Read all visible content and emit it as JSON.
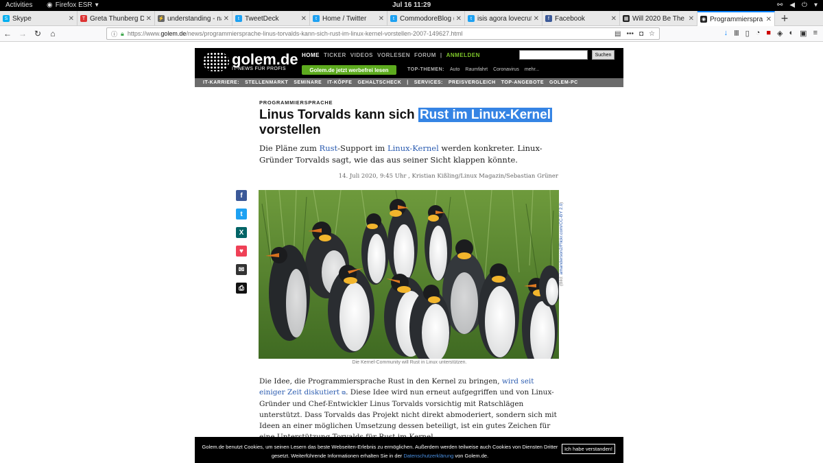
{
  "gnome": {
    "activities": "Activities",
    "app": "Firefox ESR",
    "clock": "Jul 16  11:29"
  },
  "tabs": [
    {
      "label": "Skype",
      "color": "#00aff0",
      "glyph": "S"
    },
    {
      "label": "Greta Thunberg Dr",
      "color": "#d33",
      "glyph": "T"
    },
    {
      "label": "understanding - na",
      "color": "#666",
      "glyph": "⚡"
    },
    {
      "label": "TweetDeck",
      "color": "#1da1f2",
      "glyph": "t"
    },
    {
      "label": "Home / Twitter",
      "color": "#1da1f2",
      "glyph": "t"
    },
    {
      "label": "CommodoreBlog (",
      "color": "#1da1f2",
      "glyph": "t"
    },
    {
      "label": "isis agora lovecruft",
      "color": "#1da1f2",
      "glyph": "t"
    },
    {
      "label": "Facebook",
      "color": "#3b5998",
      "glyph": "f"
    },
    {
      "label": "Will 2020 Be The",
      "color": "#222",
      "glyph": "▦"
    },
    {
      "label": "Programmierspra",
      "color": "#222",
      "glyph": "◉"
    }
  ],
  "url": {
    "scheme": "https://www.",
    "host": "golem.de",
    "path": "/news/programmiersprache-linus-torvalds-kann-sich-rust-im-linux-kernel-vorstellen-2007-149627.html"
  },
  "golem": {
    "logo": "golem.de",
    "logo_sub": "IT-NEWS FÜR PROFIS",
    "nav": [
      "HOME",
      "TICKER",
      "VIDEOS",
      "VORLESEN",
      "FORUM",
      "|",
      "ANMELDEN"
    ],
    "search_button": "Suchen",
    "adfree": "Golem.de jetzt werbefrei lesen",
    "topthemen_label": "TOP-THEMEN:",
    "topthemen": [
      "Auto",
      "Raumfahrt",
      "Coronavirus",
      "mehr..."
    ],
    "subnav": [
      "IT-KARRIERE:",
      "STELLENMARKT",
      "SEMINARE",
      "IT-KÖPFE",
      "GEHALTSCHECK",
      "|",
      "SERVICES:",
      "PREISVERGLEICH",
      "TOP-ANGEBOTE",
      "GOLEM-PC"
    ]
  },
  "article": {
    "kicker": "PROGRAMMIERSPRACHE",
    "title_a": "Linus Torvalds kann sich ",
    "title_sel": "Rust im Linux-Kernel",
    "title_b": " vorstellen",
    "teaser_1": "Die Pläne zum ",
    "teaser_link1": "Rust",
    "teaser_2": "-Support im ",
    "teaser_link2": "Linux-Kernel",
    "teaser_3": " werden konkreter. Linux-Gründer Torvalds sagt, wie das aus seiner Sicht klappen könnte.",
    "meta": "14. Juli 2020, 9:45 Uhr ,  Kristian Kißling/Linux Magazin/Sebastian Grüner",
    "credit_pre": "(Bild: ",
    "credit_link": "amanderson2/Flickr.com/CC-BY 2.0",
    "credit_post": ")",
    "caption": "Die Kernel-Community will Rust in Linux unterstützen.",
    "body_1": "Die Idee, die Programmiersprache Rust in den Kernel zu bringen, ",
    "body_link": "wird seit einiger Zeit diskutiert",
    "body_2": ". Diese Idee wird nun erneut aufgegriffen und von Linux-Gründer und Chef-Entwickler Linus Torvalds vorsichtig mit Ratschlägen unterstützt. Dass Torvalds das Projekt nicht direkt abmoderiert, sondern sich mit Ideen an einer möglichen Umsetzung dessen beteiligt, ist ein gutes Zeichen für eine Unterstützung Torvalds für Rust im Kernel."
  },
  "cookie": {
    "text_1": "Golem.de benutzt Cookies, um seinen Lesern das beste Webseiten-Erlebnis zu ermöglichen. Außerdem werden teilweise auch Cookies von Diensten Dritter gesetzt. Weiterführende Informationen erhalten Sie in der ",
    "link": "Datenschutzerklärung",
    "text_2": " von Golem.de.",
    "button": "Ich habe verstanden!"
  },
  "share": [
    {
      "name": "facebook-icon",
      "color": "#3b5998",
      "glyph": "f"
    },
    {
      "name": "twitter-icon",
      "color": "#1da1f2",
      "glyph": "t"
    },
    {
      "name": "xing-icon",
      "color": "#026466",
      "glyph": "X"
    },
    {
      "name": "pocket-icon",
      "color": "#ef4056",
      "glyph": "♥"
    },
    {
      "name": "email-icon",
      "color": "#333",
      "glyph": "✉"
    },
    {
      "name": "print-icon",
      "color": "#111",
      "glyph": "⎙"
    }
  ]
}
